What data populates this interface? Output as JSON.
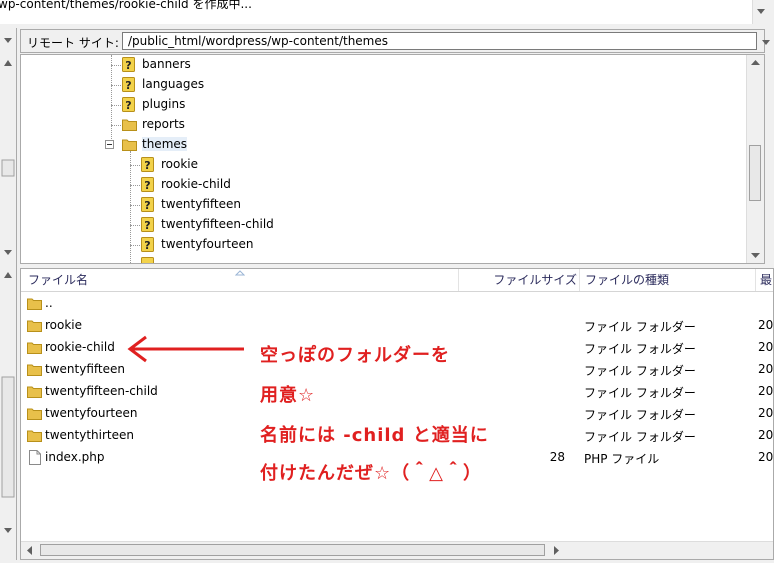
{
  "status_log": {
    "text": "wp-content/themes/rookie-child を作成中..."
  },
  "remote": {
    "label": "リモート サイト:",
    "path": "/public_html/wordpress/wp-content/themes"
  },
  "tree": {
    "items": [
      {
        "label": "banners",
        "icon": "question-folder-icon"
      },
      {
        "label": "languages",
        "icon": "question-folder-icon"
      },
      {
        "label": "plugins",
        "icon": "question-folder-icon"
      },
      {
        "label": "reports",
        "icon": "folder-icon"
      },
      {
        "label": "themes",
        "icon": "folder-open-icon",
        "expander": "⊟"
      },
      {
        "label": "rookie",
        "icon": "question-folder-icon"
      },
      {
        "label": "rookie-child",
        "icon": "question-folder-icon"
      },
      {
        "label": "twentyfifteen",
        "icon": "question-folder-icon"
      },
      {
        "label": "twentyfifteen-child",
        "icon": "question-folder-icon"
      },
      {
        "label": "twentyfourteen",
        "icon": "question-folder-icon"
      }
    ]
  },
  "list": {
    "headers": {
      "name": "ファイル名",
      "size": "ファイルサイズ",
      "type": "ファイルの種類",
      "date": "最"
    },
    "rows": [
      {
        "name": "..",
        "size": "",
        "type": "",
        "date": ""
      },
      {
        "name": "rookie",
        "size": "",
        "type": "ファイル フォルダー",
        "date": "20"
      },
      {
        "name": "rookie-child",
        "size": "",
        "type": "ファイル フォルダー",
        "date": "20"
      },
      {
        "name": "twentyfifteen",
        "size": "",
        "type": "ファイル フォルダー",
        "date": "20"
      },
      {
        "name": "twentyfifteen-child",
        "size": "",
        "type": "ファイル フォルダー",
        "date": "20"
      },
      {
        "name": "twentyfourteen",
        "size": "",
        "type": "ファイル フォルダー",
        "date": "20"
      },
      {
        "name": "twentythirteen",
        "size": "",
        "type": "ファイル フォルダー",
        "date": "20"
      },
      {
        "name": "index.php",
        "size": "28",
        "type": "PHP ファイル",
        "date": "20"
      }
    ]
  },
  "annotation": {
    "line1": "空っぽのフォルダーを",
    "line2": "用意☆",
    "line3": "名前には -child と適当に",
    "line4": "付けたんだぜ☆（＾△＾）",
    "color": "#e02020"
  },
  "colors": {
    "folder": "#e8c04a",
    "question": "#f2d24a",
    "header_text": "#2b2b5c"
  }
}
